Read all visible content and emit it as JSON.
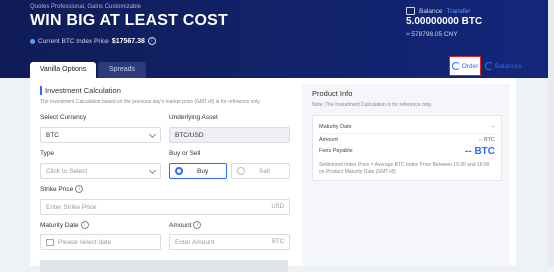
{
  "hero": {
    "tagline": "Quotes Professional, Gains Customizable",
    "title": "WIN BIG AT LEAST COST",
    "index_label": "Current BTC Index Price",
    "index_value": "$17567.38",
    "balance_label": "Balance",
    "transfer_label": "Transfer",
    "balance_btc": "5.00000000 BTC",
    "balance_cny": "≈ 578798.05 CNY"
  },
  "tabs": [
    {
      "label": "Vanilla Options",
      "active": true
    },
    {
      "label": "Spreads",
      "active": false
    }
  ],
  "links": {
    "order": "Order",
    "balances": "Balances"
  },
  "calc": {
    "title": "Investment Calculation",
    "note": "The Investment Calculation based on the previous day's market price (GMT+8) is for reference only.",
    "currency_label": "Select Currency",
    "currency_value": "BTC",
    "asset_label": "Underlying Asset",
    "asset_value": "BTC/USD",
    "type_label": "Type",
    "type_placeholder": "Click to Select",
    "side_label": "Buy or Sell",
    "buy_label": "Buy",
    "sell_label": "Sell",
    "strike_label": "Strike Price",
    "strike_placeholder": "Enter Strike Price",
    "strike_unit": "USD",
    "maturity_label": "Maturity Date",
    "maturity_placeholder": "Please select date",
    "amount_label": "Amount",
    "amount_placeholder": "Enter Amount",
    "amount_unit": "BTC"
  },
  "product": {
    "title": "Product Info",
    "note": "Note: The Investment Calculation is for reference only.",
    "maturity_label": "Maturity Date",
    "maturity_value": "--",
    "amount_label": "Amount",
    "amount_value": "-- BTC",
    "fees_label": "Fees Payable",
    "fees_value": "-- BTC",
    "settlement_note": "Settlement Index Price = Average BTC Index Price Between 15:30 and 16:00 on Product Maturity Date (GMT+8)"
  },
  "colors": {
    "accent": "#2d6bff",
    "hero": "#12236b",
    "highlight": "#e02020"
  }
}
